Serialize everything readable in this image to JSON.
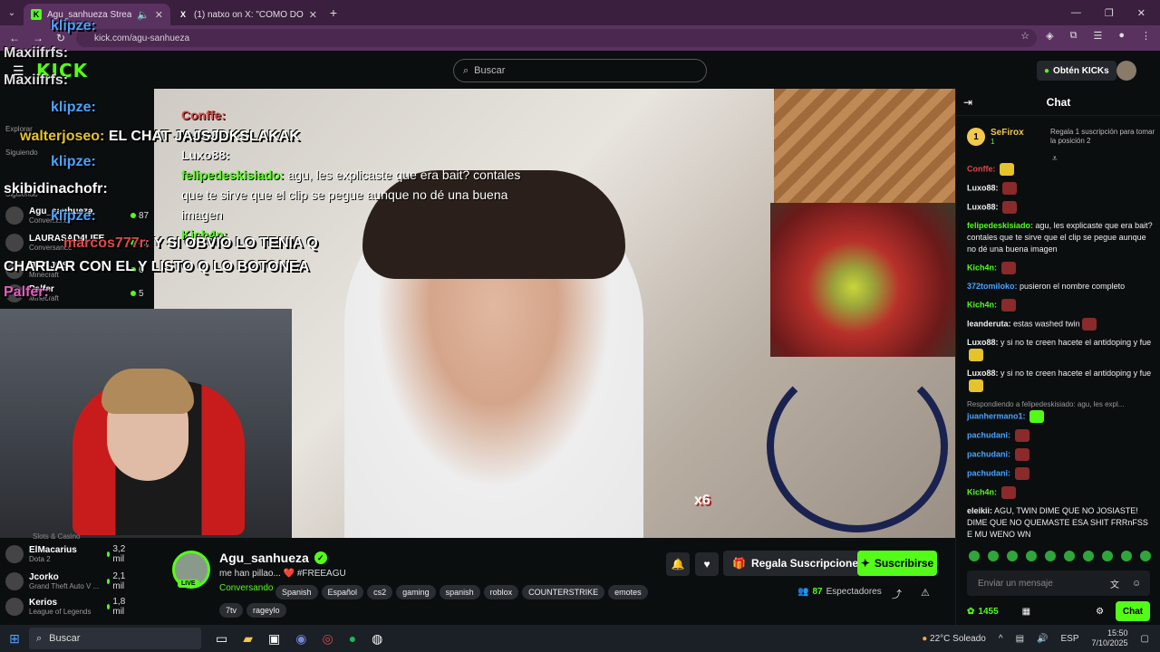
{
  "browser": {
    "tabs": [
      {
        "title": "Agu_sanhueza Stream - W",
        "icon": "K",
        "active": true
      },
      {
        "title": "(1) natxo on X: \"COMO DOLIST",
        "icon": "X",
        "active": false
      }
    ],
    "url": "kick.com/agu-sanhueza"
  },
  "header": {
    "logo": "KICK",
    "search_placeholder": "Buscar",
    "get_kicks": "Obtén KICKs"
  },
  "sidebar": {
    "items": [
      {
        "name": "walterjoseo",
        "sub": "Explorar",
        "count": ""
      },
      {
        "name": "Siguiendo",
        "sub": "",
        "count": ""
      },
      {
        "name": "Siguiendo",
        "sub": "",
        "count": ""
      },
      {
        "name": "Agu_sanhueza",
        "sub": "Conversando",
        "count": "87"
      },
      {
        "name": "LAURASAD4LIFE",
        "sub": "Conversando",
        "count": "41"
      },
      {
        "name": "ITSOJOSE",
        "sub": "Minecraft",
        "count": "6"
      },
      {
        "name": "Palfer",
        "sub": "Minecraft",
        "count": "5"
      }
    ],
    "recommended": [
      {
        "name": "ElMacarius",
        "sub": "Dota 2",
        "count": "3,2 mil"
      },
      {
        "name": "Jcorko",
        "sub": "Grand Theft Auto V ...",
        "count": "2,1 mil"
      },
      {
        "name": "Kerios",
        "sub": "League of Legends",
        "count": "1,8 mil"
      }
    ],
    "above_label": "Slots & Casino"
  },
  "overlay": {
    "lines": [
      {
        "user": "klipze:",
        "text": ""
      },
      {
        "user": "Maxiifrfs:",
        "text": ""
      },
      {
        "user": "Maxiifrfs:",
        "text": ""
      },
      {
        "user": "klipze:",
        "text": ""
      },
      {
        "user": "walterjoseo:",
        "text": "EL CHAT JAJSJDKSLAKAK"
      },
      {
        "user": "klipze:",
        "text": ""
      },
      {
        "user": "skibidinachofr:",
        "text": ""
      },
      {
        "user": "klipze:",
        "text": ""
      },
      {
        "user": "marcos777r:",
        "text": "Y SI OBVIO LO TENIA Q"
      },
      {
        "user": "",
        "text": "CHARLAR CON EL Y LISTO Q LO BOTONEA"
      },
      {
        "user": "Palfer:",
        "text": ""
      }
    ],
    "video_chat": [
      {
        "user": "Conffe:",
        "text": ""
      },
      {
        "user": "Luxo88:",
        "text": ""
      },
      {
        "user": "Luxo88:",
        "text": ""
      },
      {
        "user": "felipedeskisiado:",
        "text": "agu, les explicaste que era bait? contales que te sirve que el clip se pegue aunque no dé una buena imagen"
      },
      {
        "user": "Kich4n:",
        "text": ""
      }
    ],
    "combo": "x6"
  },
  "stream": {
    "name": "Agu_sanhueza",
    "title": "me han pillao... ❤️ #FREEAGU",
    "category": "Conversando",
    "live_label": "LIVE",
    "tags": [
      "Spanish",
      "Español",
      "cs2",
      "gaming",
      "spanish",
      "roblox",
      "COUNTERSTRIKE",
      "emotes",
      "7tv",
      "rageylo"
    ],
    "gift_label": "Regala Suscripciones",
    "subscribe_label": "Suscribirse",
    "viewers": "87",
    "viewers_label": "Espectadores"
  },
  "chat": {
    "title": "Chat",
    "pinned": {
      "rank": "1",
      "name": "SeFirox",
      "count": "1",
      "text": "Regala 1 suscripción para tomar la posición 2"
    },
    "messages": [
      {
        "user": "Conffe:",
        "text": "",
        "color": "#e04848",
        "emote": "y"
      },
      {
        "user": "Luxo88:",
        "text": "",
        "color": "#eeeeee",
        "emote": "r"
      },
      {
        "user": "Luxo88:",
        "text": "",
        "color": "#eeeeee",
        "emote": "r"
      },
      {
        "user": "felipedeskisiado:",
        "text": "agu, les explicaste que era bait? contales que te sirve que el clip se pegue aunque no dé una buena imagen",
        "color": "#53fc18",
        "emote": ""
      },
      {
        "user": "Kich4n:",
        "text": "",
        "color": "#53fc18",
        "emote": "r"
      },
      {
        "user": "372tomiloko:",
        "text": "pusieron el nombre completo",
        "color": "#4aa3ff",
        "emote": ""
      },
      {
        "user": "Kich4n:",
        "text": "",
        "color": "#53fc18",
        "emote": "r"
      },
      {
        "user": "leanderuta:",
        "text": "estas washed twin",
        "color": "#eeeeee",
        "emote": "r"
      },
      {
        "user": "Luxo88:",
        "text": "y si no te creen hacete el antidoping y fue",
        "color": "#eeeeee",
        "emote": "y"
      },
      {
        "user": "Luxo88:",
        "text": "y si no te creen hacete el antidoping y fue",
        "color": "#eeeeee",
        "emote": "y"
      },
      {
        "user": "juanhermano1:",
        "text": "",
        "color": "#4aa3ff",
        "emote": "g",
        "reply": "Respondiendo a felipedeskisiado: agu, les expl..."
      },
      {
        "user": "pachudani:",
        "text": "",
        "color": "#4aa3ff",
        "emote": "r"
      },
      {
        "user": "pachudani:",
        "text": "",
        "color": "#4aa3ff",
        "emote": "r"
      },
      {
        "user": "pachudani:",
        "text": "",
        "color": "#4aa3ff",
        "emote": "r"
      },
      {
        "user": "Kich4n:",
        "text": "",
        "color": "#53fc18",
        "emote": "r"
      },
      {
        "user": "eleikii:",
        "text": "AGU, TWIN DIME QUE NO JOSIASTE! DIME QUE NO QUEMASTE ESA SHIT FRRnFSS E MU WENO WN",
        "color": "#eeeeee",
        "emote": ""
      }
    ],
    "input_placeholder": "Enviar un mensaje",
    "points": "1455",
    "send_label": "Chat"
  },
  "taskbar": {
    "search_placeholder": "Buscar",
    "weather": "22°C Soleado",
    "lang": "ESP",
    "time": "15:50",
    "date": "7/10/2025"
  }
}
